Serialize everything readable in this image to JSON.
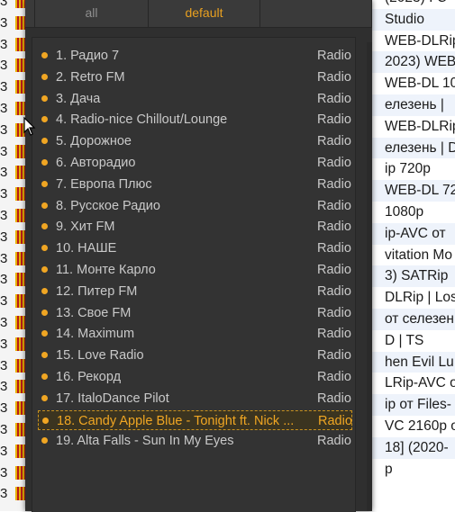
{
  "tabs": [
    {
      "label": "all"
    },
    {
      "label": "default"
    }
  ],
  "stations": [
    {
      "title": "1. Радио 7",
      "type": "Radio"
    },
    {
      "title": "2. Retro FM",
      "type": "Radio"
    },
    {
      "title": "3. Дача",
      "type": "Radio"
    },
    {
      "title": "4. Radio-nice Chillout/Lounge",
      "type": "Radio"
    },
    {
      "title": "5. Дорожное",
      "type": "Radio"
    },
    {
      "title": "6. Авторадио",
      "type": "Radio"
    },
    {
      "title": "7. Европа Плюс",
      "type": "Radio"
    },
    {
      "title": "8. Русское Радио",
      "type": "Radio"
    },
    {
      "title": "9. Хит FM",
      "type": "Radio"
    },
    {
      "title": "10. НАШЕ",
      "type": "Radio"
    },
    {
      "title": "11. Монте Карло",
      "type": "Radio"
    },
    {
      "title": "12. Питер FM",
      "type": "Radio"
    },
    {
      "title": "13. Свое FM",
      "type": "Radio"
    },
    {
      "title": "14. Maximum",
      "type": "Radio"
    },
    {
      "title": "15. Love Radio",
      "type": "Radio"
    },
    {
      "title": "16. Рекорд",
      "type": "Radio"
    },
    {
      "title": "17. ItaloDance Pilot",
      "type": "Radio"
    },
    {
      "title": "18. Candy Apple Blue - Tonight ft. Nick ...",
      "type": "Radio",
      "selected": true
    },
    {
      "title": "19. Alta Falls - Sun In My Eyes",
      "type": "Radio"
    }
  ],
  "background_right": [
    "(2023) I C",
    "Studio",
    "WEB-DLRip",
    "2023) WEB-",
    "WEB-DL 10",
    "елезень |",
    "WEB-DLRip",
    "елезень | D",
    "ip 720p",
    "WEB-DL 72",
    "1080p",
    "ip-AVC от",
    "vitation Mo",
    "3) SATRip",
    "DLRip | Los",
    "от селезен",
    "D | TS",
    "hen Evil Lu",
    "LRip-AVC о",
    "ip от Files-",
    "VC 2160p о",
    "18] (2020-",
    "p"
  ],
  "background_left_digit": "3",
  "colors": {
    "accent": "#f0a623",
    "popup_bg": "#2f2f2f",
    "text": "#c9c9c9"
  }
}
